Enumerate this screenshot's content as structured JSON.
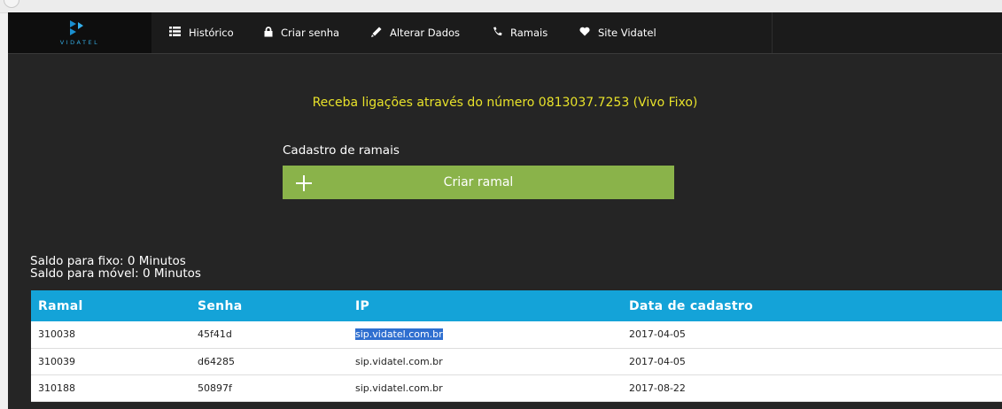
{
  "logo": {
    "text": "VIDATEL"
  },
  "nav": [
    {
      "icon": "list-icon",
      "label": "Histórico"
    },
    {
      "icon": "lock-icon",
      "label": "Criar senha"
    },
    {
      "icon": "pencil-icon",
      "label": "Alterar Dados"
    },
    {
      "icon": "phone-icon",
      "label": "Ramais"
    },
    {
      "icon": "heart-icon",
      "label": "Site Vidatel"
    }
  ],
  "promo": "Receba ligações através do número 0813037.7253 (Vivo Fixo)",
  "section": {
    "title": "Cadastro de ramais",
    "create_button": "Criar ramal"
  },
  "saldo": {
    "fixo": "Saldo para fixo: 0 Minutos",
    "movel": "Saldo para móvel: 0 Minutos"
  },
  "table": {
    "headers": [
      "Ramal",
      "Senha",
      "IP",
      "Data de cadastro"
    ],
    "rows": [
      [
        "310038",
        "45f41d",
        "sip.vidatel.com.br",
        "2017-04-05"
      ],
      [
        "310039",
        "d64285",
        "sip.vidatel.com.br",
        "2017-04-05"
      ],
      [
        "310188",
        "50897f",
        "sip.vidatel.com.br",
        "2017-08-22"
      ]
    ]
  },
  "colors": {
    "navbar": "#1b1b1b",
    "background": "#252525",
    "accent_blue": "#14a3d8",
    "button_green": "#8ab34a",
    "promo_yellow": "#e8e22a",
    "selection": "#2f6fd0"
  }
}
